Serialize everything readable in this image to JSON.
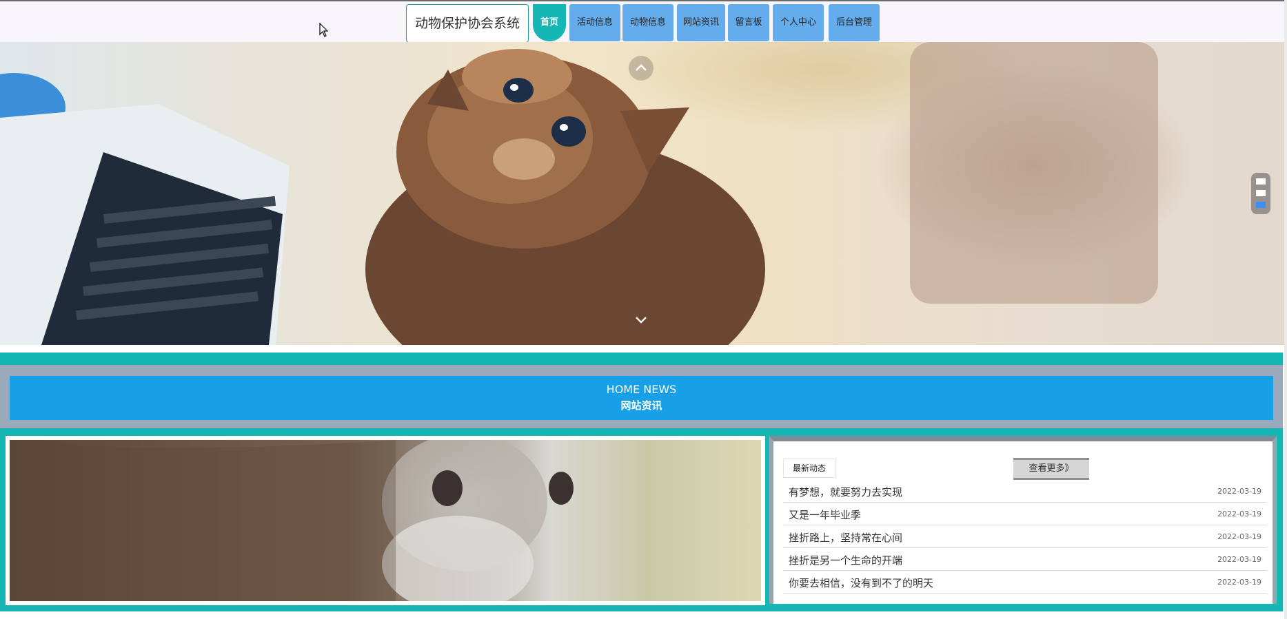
{
  "header": {
    "brand": "动物保护协会系统",
    "nav": [
      {
        "label": "首页",
        "active": true
      },
      {
        "label": "活动信息",
        "active": false
      },
      {
        "label": "动物信息",
        "active": false
      },
      {
        "label": "网站资讯",
        "active": false
      },
      {
        "label": "留言板",
        "active": false
      },
      {
        "label": "个人中心",
        "active": false
      },
      {
        "label": "后台管理",
        "active": false
      }
    ]
  },
  "hero": {
    "prev_icon": "chevron-up-icon",
    "next_icon": "chevron-down-icon",
    "slide_count": 3,
    "active_slide": 3
  },
  "news": {
    "title_en": "HOME NEWS",
    "title_cn": "网站资讯",
    "latest_label": "最新动态",
    "more_label": "查看更多》",
    "items": [
      {
        "title": "有梦想，就要努力去实现",
        "date": "2022-03-19"
      },
      {
        "title": "又是一年毕业季",
        "date": "2022-03-19"
      },
      {
        "title": "挫折路上，坚持常在心间",
        "date": "2022-03-19"
      },
      {
        "title": "挫折是另一个生命的开端",
        "date": "2022-03-19"
      },
      {
        "title": "你要去相信，没有到不了的明天",
        "date": "2022-03-19"
      }
    ]
  },
  "colors": {
    "teal": "#15b6b4",
    "nav_blue": "#65acec",
    "title_blue": "#17a0e8"
  }
}
